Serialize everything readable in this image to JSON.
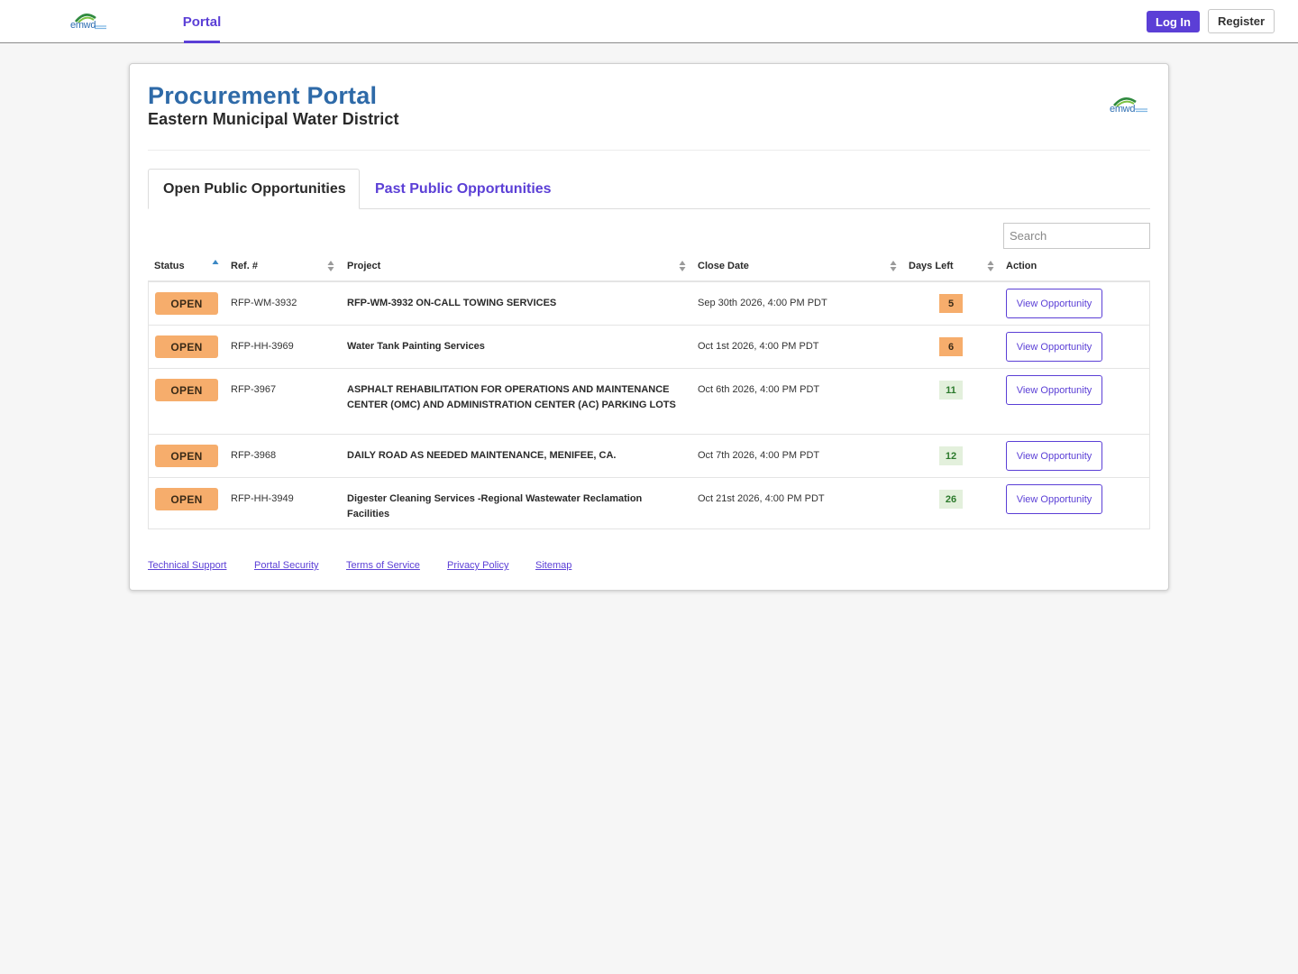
{
  "nav": {
    "logo_text": "emwd",
    "tab_label": "Portal",
    "login_label": "Log In",
    "register_label": "Register"
  },
  "header": {
    "title": "Procurement Portal",
    "subtitle": "Eastern Municipal Water District",
    "logo_text": "emwd"
  },
  "tabs": [
    {
      "label": "Open Public Opportunities",
      "active": true
    },
    {
      "label": "Past Public Opportunities",
      "active": false
    }
  ],
  "search": {
    "placeholder": "Search",
    "value": ""
  },
  "table": {
    "columns": [
      "Status",
      "Ref. #",
      "Project",
      "Close Date",
      "Days Left",
      "Action"
    ],
    "rows": [
      {
        "status": "OPEN",
        "ref": "RFP-WM-3932",
        "project": "RFP-WM-3932 ON-CALL TOWING SERVICES",
        "close_date": "Sep 30th 2026, 4:00 PM PDT",
        "days_left": "5",
        "action": "View Opportunity"
      },
      {
        "status": "OPEN",
        "ref": "RFP-HH-3969",
        "project": "Water Tank Painting Services",
        "close_date": "Oct 1st 2026, 4:00 PM PDT",
        "days_left": "6",
        "action": "View Opportunity"
      },
      {
        "status": "OPEN",
        "ref": "RFP-3967",
        "project": "ASPHALT REHABILITATION FOR OPERATIONS AND MAINTENANCE CENTER (OMC) AND ADMINISTRATION CENTER (AC) PARKING LOTS",
        "close_date": "Oct 6th 2026, 4:00 PM PDT",
        "days_left": "11",
        "action": "View Opportunity"
      },
      {
        "status": "OPEN",
        "ref": "RFP-3968",
        "project": "DAILY ROAD AS NEEDED MAINTENANCE, MENIFEE, CA.",
        "close_date": "Oct 7th 2026, 4:00 PM PDT",
        "days_left": "12",
        "action": "View Opportunity"
      },
      {
        "status": "OPEN",
        "ref": "RFP-HH-3949",
        "project": "Digester Cleaning Services -Regional Wastewater Reclamation Facilities",
        "close_date": "Oct 21st 2026, 4:00 PM PDT",
        "days_left": "26",
        "action": "View Opportunity"
      }
    ]
  },
  "footer": {
    "links": [
      "Technical Support",
      "Portal Security",
      "Terms of Service",
      "Privacy Policy",
      "Sitemap"
    ]
  },
  "colors": {
    "accent": "#5b3fd6",
    "title_blue": "#2e6aa8",
    "open_badge": "#f6ad6c",
    "days_ok_bg": "#e3f0dc",
    "days_ok_text": "#2c7a2c"
  },
  "icons": {
    "sort_asc": "sort-ascending-icon",
    "sort_both": "sort-both-icon",
    "logo": "emwd-logo"
  }
}
